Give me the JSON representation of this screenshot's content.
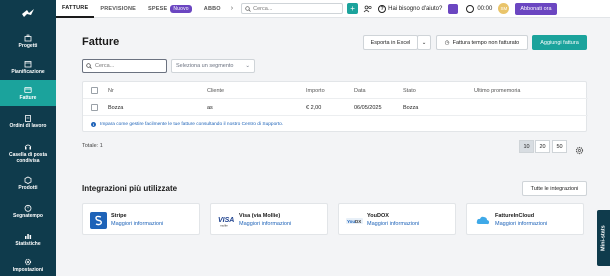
{
  "sidebar": {
    "items": [
      {
        "label": "Progetti",
        "icon": "briefcase-icon"
      },
      {
        "label": "Pianificazione",
        "icon": "calendar-icon"
      },
      {
        "label": "Fatture",
        "icon": "invoice-icon",
        "active": true
      },
      {
        "label": "Ordini di lavoro",
        "icon": "clipboard-icon"
      },
      {
        "label": "Casella di posta condivisa",
        "icon": "inbox-icon"
      },
      {
        "label": "Prodotti",
        "icon": "box-icon"
      },
      {
        "label": "Segnatempo",
        "icon": "clock-icon"
      },
      {
        "label": "Statistiche",
        "icon": "chart-icon"
      },
      {
        "label": "Impostazioni",
        "icon": "gear-icon"
      }
    ]
  },
  "topbar": {
    "tabs": [
      {
        "label": "FATTURE"
      },
      {
        "label": "PREVISIONE"
      },
      {
        "label": "SPESE"
      },
      {
        "label": "ABBO"
      }
    ],
    "new_badge": "Nuovo",
    "search_placeholder": "Cerca...",
    "help": "Hai bisogno d'aiuto?",
    "timer": "00:00",
    "avatar": "SM",
    "subscribe": "Abbonati ora"
  },
  "main": {
    "title": "Fatture",
    "export_label": "Esporta in Excel",
    "time_label": "Fattura tempo non fatturato",
    "add_label": "Aggiungi fattura",
    "search_placeholder": "Cerca...",
    "segment_placeholder": "Seleziona un segmento",
    "table": {
      "headers": [
        "Nr",
        "Cliente",
        "Importo",
        "Data",
        "Stato",
        "Ultimo promemoria"
      ],
      "rows": [
        {
          "nr": "Bozza",
          "cliente": "as",
          "importo": "€ 2,00",
          "data": "06/05/2025",
          "stato": "Bozza",
          "promemoria": ""
        }
      ],
      "info": "Impara come gestire facilmente le tue fatture consultando il nostro Centro di Supporto."
    },
    "total": "Totale: 1",
    "page_sizes": [
      "10",
      "20",
      "50"
    ],
    "selected_page_size": "10",
    "integrations_title": "Integrazioni più utilizzate",
    "all_integrations": "Tutte le integrazioni",
    "integrations": [
      {
        "name": "Stripe",
        "more": "Maggiori informazioni"
      },
      {
        "name": "Visa (via Mollie)",
        "more": "Maggiori informazioni"
      },
      {
        "name": "YouDOX",
        "more": "Maggiori informazioni"
      },
      {
        "name": "FattureInCloud",
        "more": "Maggiori informazioni"
      }
    ],
    "mini_stats": "Mini-stats"
  },
  "colors": {
    "sidebar_bg": "#0f3b4c",
    "accent": "#1ba39c",
    "purple": "#6b46c1",
    "link": "#1e63b8"
  }
}
